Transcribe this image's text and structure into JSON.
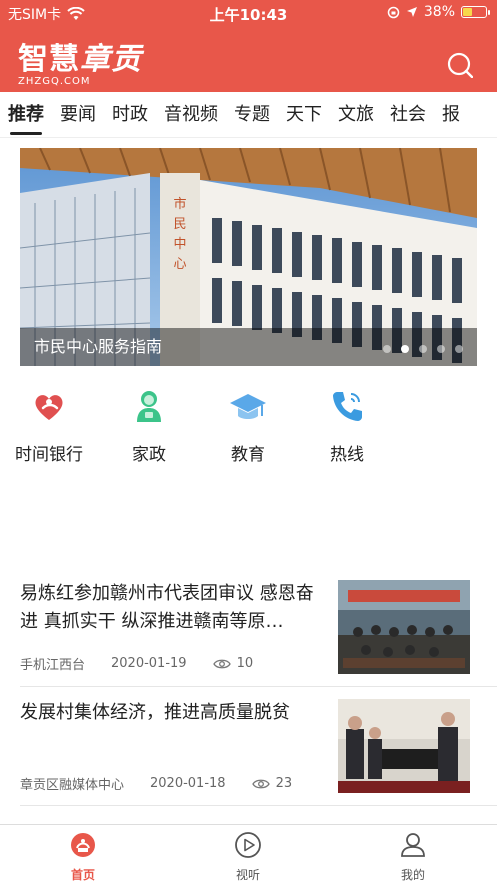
{
  "status_bar": {
    "carrier": "无SIM卡",
    "time": "上午10:43",
    "battery": "38%",
    "battery_level": 0.38
  },
  "header": {
    "logo_text": "智慧",
    "logo_script": "章贡",
    "logo_sub": "ZHZGQ.COM",
    "search_icon": "search-icon"
  },
  "tabs": [
    "推荐",
    "要闻",
    "时政",
    "音视频",
    "专题",
    "天下",
    "文旅",
    "社会",
    "报"
  ],
  "banner": {
    "caption": "市民中心服务指南",
    "dot_count": 5,
    "active_dot": 1
  },
  "services": [
    {
      "label": "时间银行",
      "icon": "heart-hand-icon"
    },
    {
      "label": "家政",
      "icon": "housekeeper-icon"
    },
    {
      "label": "教育",
      "icon": "graduation-cap-icon"
    },
    {
      "label": "热线",
      "icon": "phone-icon"
    }
  ],
  "news": [
    {
      "title": "易炼红参加赣州市代表团审议 感恩奋进 真抓实干 纵深推进赣南等原…",
      "source": "手机江西台",
      "date": "2020-01-19",
      "views": "10"
    },
    {
      "title": "发展村集体经济，推进高质量脱贫",
      "source": "章贡区融媒体中心",
      "date": "2020-01-18",
      "views": "23"
    }
  ],
  "bottom_nav": [
    {
      "label": "首页",
      "icon": "home-logo-icon",
      "active": true
    },
    {
      "label": "视听",
      "icon": "play-icon",
      "active": false
    },
    {
      "label": "我的",
      "icon": "user-icon",
      "active": false
    }
  ],
  "colors": {
    "brand": "#E8574A",
    "battery_fill": "#F7D84B"
  }
}
